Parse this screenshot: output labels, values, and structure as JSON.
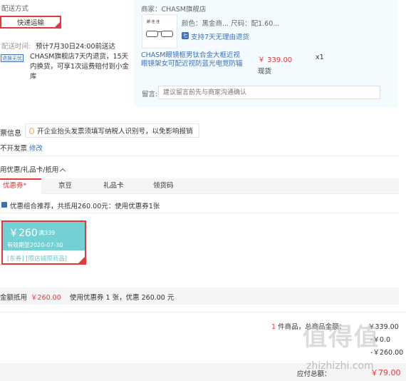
{
  "shipping": {
    "label": "配送方式",
    "method_button": "快递运输",
    "time_label": "配送时间:",
    "time_value": "预计7月30日24:00前送达",
    "return_badge": "退换无忧",
    "return_text": "CHASM旗舰店7天内退货，15天内换货，可享1次运费赔付到小金库"
  },
  "shop": {
    "name": "商家：CHASM旗舰店",
    "thumb_logo": "朗 佳 佳",
    "attr_line": "颜色：黑金商...    尺码：配1.60...",
    "protect_icon": "七",
    "protect_text": "支持7天无理由退货",
    "product_title": "CHASM眼镜框男钛合金大框近视眼镜架女可配近视防蓝光电竞防辐",
    "price": "￥ 339.00",
    "stock": "现货",
    "qty": "x1",
    "message_label": "留言:",
    "message_placeholder": "建议留言前先与商家沟通确认"
  },
  "invoice": {
    "label": "票信息",
    "tip": "开企业抬头发票须填写纳税人识别号，以免影响报销",
    "type": "不开发票",
    "edit": "修改"
  },
  "coupons": {
    "title": "用优惠/礼品卡/抵用",
    "tabs": [
      "优惠券*",
      "京豆",
      "礼品卡",
      "领货码"
    ],
    "recommend": "优惠组合推荐，共抵用260.00元：使用优惠券1张",
    "coupon_amount": "￥260",
    "coupon_min": "满339",
    "coupon_valid": "有效期至2020-07-30",
    "coupon_scope": "[东券] [限店铺限商品]",
    "discount_label": "金额抵用",
    "discount_amount": "￥260.00",
    "discount_note": "使用优惠券 1 张，优惠 260.00 元"
  },
  "summary": {
    "count_prefix": "1",
    "count_text": "件商品，总商品金额：",
    "goods_amount": "￥339.00",
    "line2": "-￥0.0",
    "line3": "-￥260.00",
    "total_label": "应付总额：",
    "total_amount": "￥79.00"
  },
  "watermark": {
    "text": "值得值",
    "url": "zhizhizhi.com"
  },
  "colors": {
    "accent": "#e4393c",
    "link": "#3b6fb6",
    "coupon": "#73d1d4",
    "panel": "#f3fbfe"
  }
}
